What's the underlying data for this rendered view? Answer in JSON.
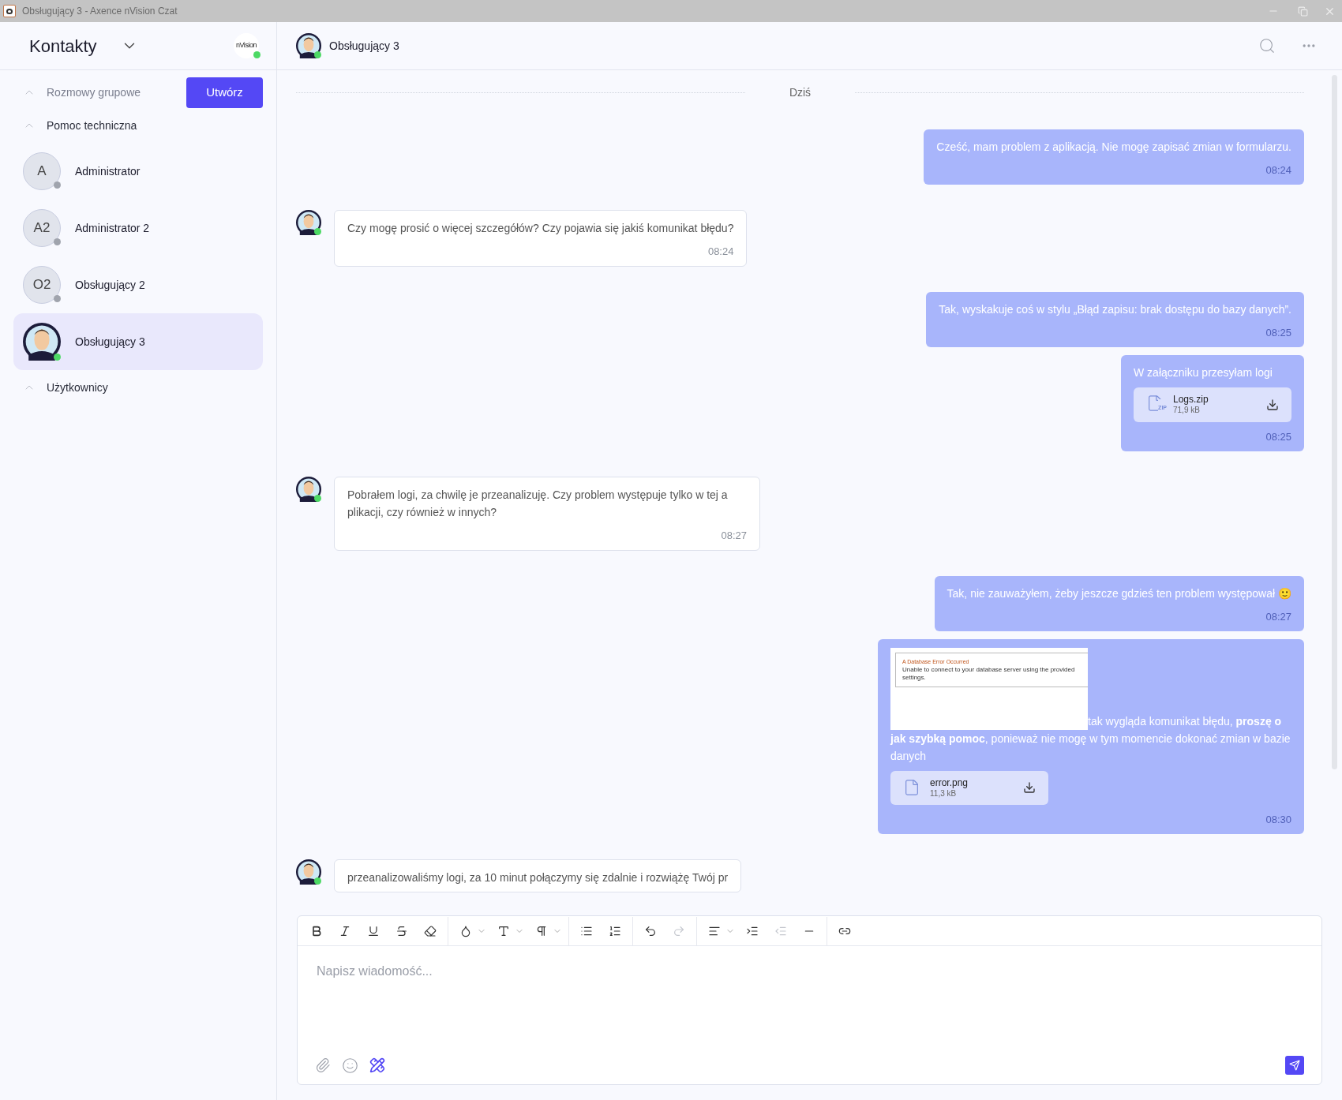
{
  "window": {
    "title": "Obsługujący 3 - Axence nVision Czat"
  },
  "sidebar": {
    "title": "Kontakty",
    "logo": "nVision",
    "logo_online": true,
    "create_button": "Utwórz",
    "sections": [
      {
        "title": "Rozmowy grupowe",
        "expanded": true,
        "muted": true
      },
      {
        "title": "Pomoc techniczna",
        "expanded": true,
        "muted": false,
        "contacts": [
          {
            "kind": "initials",
            "initials": "A",
            "name": "Administrator",
            "online": false,
            "selected": false
          },
          {
            "kind": "initials",
            "initials": "A2",
            "name": "Administrator 2",
            "online": false,
            "selected": false
          },
          {
            "kind": "initials",
            "initials": "O2",
            "name": "Obsługujący 2",
            "online": false,
            "selected": false
          },
          {
            "kind": "figure",
            "name": "Obsługujący 3",
            "online": true,
            "selected": true
          }
        ]
      },
      {
        "title": "Użytkownicy",
        "expanded": true,
        "muted": false
      }
    ]
  },
  "chat": {
    "name": "Obsługujący 3",
    "online": true,
    "day": "Dziś",
    "messages": [
      {
        "kind": "sent",
        "text": "Cześć, mam problem z aplikacją. Nie mogę zapisać zmian w formularzu.",
        "time": "08:24"
      },
      {
        "kind": "received",
        "text": "Czy mogę prosić o więcej szczegółów? Czy pojawia się jakiś komunikat błędu?",
        "time": "08:24"
      },
      {
        "kind": "sent",
        "text": "Tak, wyskakuje coś w stylu „Błąd zapisu: brak dostępu do bazy danych”.",
        "time": "08:25"
      },
      {
        "kind": "sent",
        "text": "W załączniku przesyłam logi",
        "time": "08:25",
        "attachment": {
          "kind": "zip",
          "badge": "ZIP",
          "name": "Logs.zip",
          "size": "71,9 kB"
        }
      },
      {
        "kind": "received",
        "text": "Pobrałem logi, za chwilę je przeanalizuję. Czy problem występuje tylko w tej a plikacji, czy również w innych?",
        "time": "08:27"
      },
      {
        "kind": "sent",
        "text": "Tak, nie zauważyłem, żeby jeszcze gdzieś ten problem występował 🙂",
        "time": "08:27"
      },
      {
        "kind": "sent",
        "image": {
          "title": "A Database Error Occurred",
          "text": "Unable to connect to your database server using the provided settings."
        },
        "text": "tak wygląda komunikat błędu, **proszę o jak szybką pomoc**, ponieważ nie mogę w tym momencie dokonać zmian w bazie danych",
        "time": "08:30",
        "attachment": {
          "kind": "file",
          "name": "error.png",
          "size": "11,3 kB"
        }
      },
      {
        "kind": "received",
        "text": "przeanalizowaliśmy logi, za 10 minut połączymy się zdalnie i rozwiążę Twój pr"
      }
    ]
  },
  "editor": {
    "toolbar": [
      {
        "kind": "bold",
        "disabled": false
      },
      {
        "kind": "italic",
        "disabled": false
      },
      {
        "kind": "underline",
        "disabled": false
      },
      {
        "kind": "strike",
        "disabled": false
      },
      {
        "kind": "eraser",
        "disabled": false
      },
      {
        "kind": "sep"
      },
      {
        "kind": "color",
        "disabled": false,
        "dropdown": true
      },
      {
        "kind": "size",
        "disabled": false,
        "dropdown": true
      },
      {
        "kind": "paragraph",
        "disabled": false,
        "dropdown": true
      },
      {
        "kind": "sep"
      },
      {
        "kind": "bullets",
        "disabled": false
      },
      {
        "kind": "numbers",
        "disabled": false
      },
      {
        "kind": "sep"
      },
      {
        "kind": "undo",
        "disabled": false
      },
      {
        "kind": "redo",
        "disabled": true
      },
      {
        "kind": "sep"
      },
      {
        "kind": "align",
        "disabled": false,
        "dropdown": true
      },
      {
        "kind": "indent",
        "disabled": false
      },
      {
        "kind": "outdent",
        "disabled": true
      },
      {
        "kind": "rule",
        "disabled": false
      },
      {
        "kind": "sep"
      },
      {
        "kind": "link",
        "disabled": false
      }
    ],
    "placeholder": "Napisz wiadomość..."
  }
}
